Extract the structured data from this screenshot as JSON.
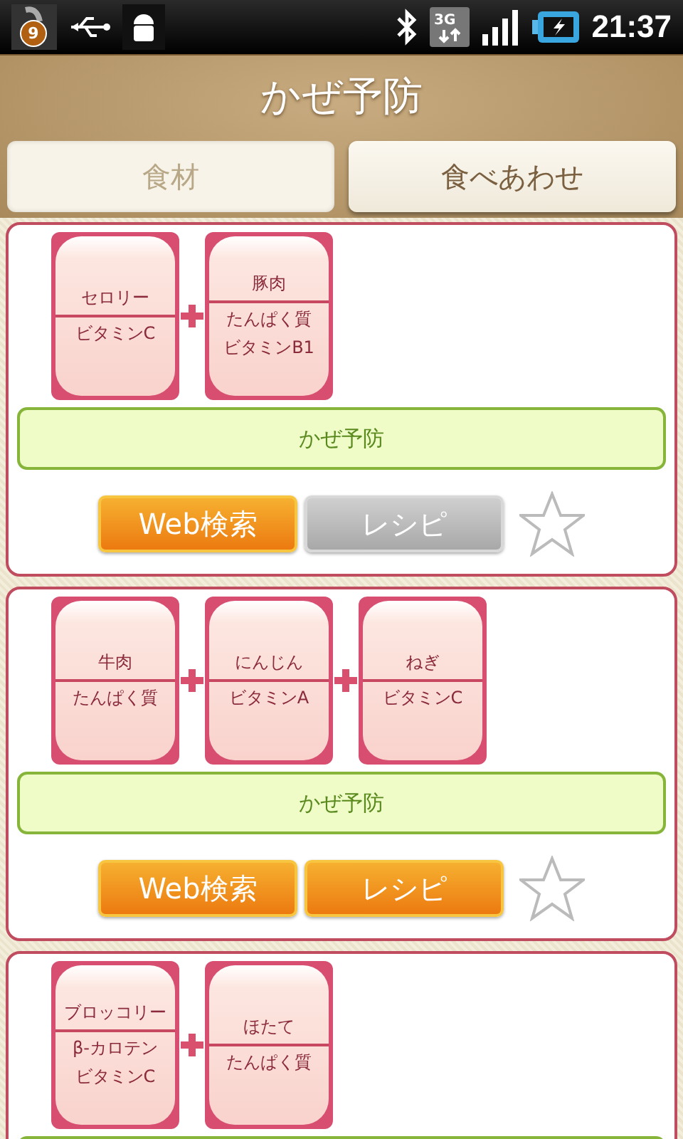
{
  "status_bar": {
    "notification_count": "9",
    "network": "3G",
    "time": "21:37"
  },
  "header": {
    "title": "かぜ予防"
  },
  "tabs": [
    {
      "label": "食材",
      "selected": false
    },
    {
      "label": "食べあわせ",
      "selected": true
    }
  ],
  "combinations": [
    {
      "foods": [
        {
          "name": "セロリー",
          "nutrients": [
            "ビタミンC"
          ]
        },
        {
          "name": "豚肉",
          "nutrients": [
            "たんぱく質",
            "ビタミンB1"
          ]
        }
      ],
      "tag": "かぜ予防",
      "buttons": [
        {
          "label": "Web検索",
          "disabled": false
        },
        {
          "label": "レシピ",
          "disabled": true
        }
      ],
      "favorite": false
    },
    {
      "foods": [
        {
          "name": "牛肉",
          "nutrients": [
            "たんぱく質"
          ]
        },
        {
          "name": "にんじん",
          "nutrients": [
            "ビタミンA"
          ]
        },
        {
          "name": "ねぎ",
          "nutrients": [
            "ビタミンC"
          ]
        }
      ],
      "tag": "かぜ予防",
      "buttons": [
        {
          "label": "Web検索",
          "disabled": false
        },
        {
          "label": "レシピ",
          "disabled": false
        }
      ],
      "favorite": false
    },
    {
      "foods": [
        {
          "name": "ブロッコリー",
          "nutrients": [
            "β-カロテン",
            "ビタミンC"
          ]
        },
        {
          "name": "ほたて",
          "nutrients": [
            "たんぱく質"
          ]
        }
      ]
    }
  ]
}
